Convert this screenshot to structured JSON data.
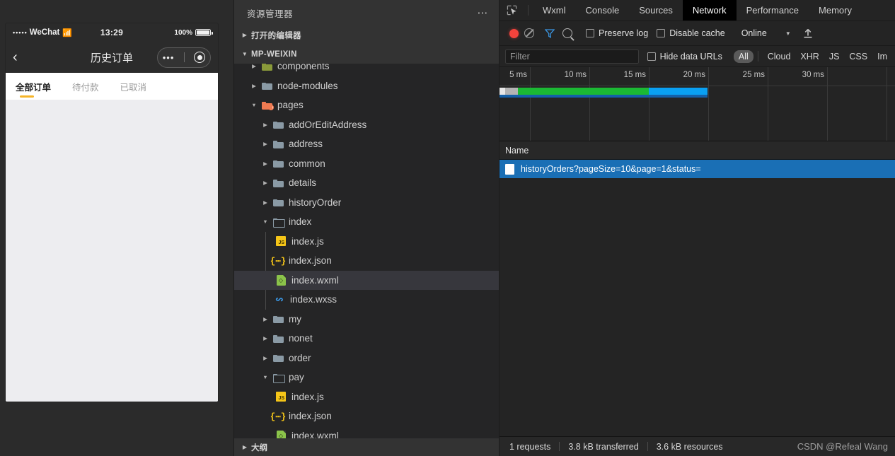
{
  "simulator": {
    "status_bar": {
      "signal_dots": "•••••",
      "carrier": "WeChat",
      "wifi_icon": "wifi-icon",
      "time": "13:29",
      "battery_percent": "100%"
    },
    "nav_bar": {
      "back_icon": "chevron-left-icon",
      "title": "历史订单",
      "more_icon": "more-dots-icon",
      "target_icon": "target-circle-icon"
    },
    "tabs": [
      {
        "label": "全部订单",
        "active": true
      },
      {
        "label": "待付款",
        "active": false
      },
      {
        "label": "已取消",
        "active": false
      }
    ],
    "accent_color": "#f5b428",
    "content_bg": "#ededf0"
  },
  "explorer": {
    "title": "资源管理器",
    "more_icon": "ellipsis-icon",
    "sections": [
      {
        "label": "打开的编辑器",
        "expanded": false
      },
      {
        "label": "MP-WEIXIN",
        "expanded": true
      }
    ],
    "footer": {
      "label": "大纲",
      "expanded": false
    },
    "tree": [
      {
        "label": "components",
        "type": "folder-special",
        "indent": 1,
        "expanded": false,
        "clipped": true
      },
      {
        "label": "node-modules",
        "type": "folder",
        "indent": 1,
        "expanded": false
      },
      {
        "label": "pages",
        "type": "folder-pages",
        "indent": 1,
        "expanded": true
      },
      {
        "label": "addOrEditAddress",
        "type": "folder",
        "indent": 2,
        "expanded": false
      },
      {
        "label": "address",
        "type": "folder",
        "indent": 2,
        "expanded": false
      },
      {
        "label": "common",
        "type": "folder",
        "indent": 2,
        "expanded": false
      },
      {
        "label": "details",
        "type": "folder",
        "indent": 2,
        "expanded": false
      },
      {
        "label": "historyOrder",
        "type": "folder",
        "indent": 2,
        "expanded": false
      },
      {
        "label": "index",
        "type": "folder-open",
        "indent": 2,
        "expanded": true
      },
      {
        "label": "index.js",
        "type": "js",
        "indent": 3
      },
      {
        "label": "index.json",
        "type": "json",
        "indent": 3
      },
      {
        "label": "index.wxml",
        "type": "wxml",
        "indent": 3,
        "selected": true
      },
      {
        "label": "index.wxss",
        "type": "wxss",
        "indent": 3
      },
      {
        "label": "my",
        "type": "folder",
        "indent": 2,
        "expanded": false
      },
      {
        "label": "nonet",
        "type": "folder",
        "indent": 2,
        "expanded": false
      },
      {
        "label": "order",
        "type": "folder",
        "indent": 2,
        "expanded": false
      },
      {
        "label": "pay",
        "type": "folder-open",
        "indent": 2,
        "expanded": true
      },
      {
        "label": "index.js",
        "type": "js",
        "indent": 3
      },
      {
        "label": "index.json",
        "type": "json",
        "indent": 3
      },
      {
        "label": "index.wxml",
        "type": "wxml",
        "indent": 3
      }
    ]
  },
  "devtools": {
    "inspect_icon": "inspect-element-icon",
    "tabs": [
      {
        "label": "Wxml",
        "active": false
      },
      {
        "label": "Console",
        "active": false
      },
      {
        "label": "Sources",
        "active": false
      },
      {
        "label": "Network",
        "active": true
      },
      {
        "label": "Performance",
        "active": false
      },
      {
        "label": "Memory",
        "active": false
      }
    ],
    "toolbar": {
      "record_icon": "record-red-dot-icon",
      "clear_icon": "clear-circle-slash-icon",
      "filter_icon": "funnel-filter-icon",
      "search_icon": "search-magnifier-icon",
      "preserve_log": {
        "label": "Preserve log",
        "checked": false
      },
      "disable_cache": {
        "label": "Disable cache",
        "checked": false
      },
      "throttling": "Online",
      "dropdown_icon": "chevron-down-icon",
      "upload_icon": "upload-arrow-icon"
    },
    "filterbar": {
      "filter_placeholder": "Filter",
      "filter_value": "",
      "hide_data_urls": {
        "label": "Hide data URLs",
        "checked": false
      },
      "types": [
        {
          "label": "All",
          "active": true
        },
        {
          "label": "Cloud",
          "active": false
        },
        {
          "label": "XHR",
          "active": false
        },
        {
          "label": "JS",
          "active": false
        },
        {
          "label": "CSS",
          "active": false
        },
        {
          "label": "Im",
          "active": false
        }
      ]
    },
    "overview": {
      "ticks": [
        "5 ms",
        "10 ms",
        "15 ms",
        "20 ms",
        "25 ms",
        "30 ms"
      ],
      "bar_segments": [
        {
          "name": "queue",
          "color": "#cfcfcf",
          "width_pct": 2.9,
          "muted": true
        },
        {
          "name": "stalled",
          "color": "#b0b0b0",
          "width_pct": 6.2
        },
        {
          "name": "waiting",
          "color": "#1bb934",
          "width_pct": 62.5
        },
        {
          "name": "download",
          "color": "#0aa0f2",
          "width_pct": 20.0
        }
      ],
      "total_bar_color": "#1560a8"
    },
    "list": {
      "column_header": "Name",
      "rows": [
        {
          "name": "historyOrders?pageSize=10&page=1&status=",
          "selected": true,
          "icon": "document-icon"
        }
      ]
    },
    "status_bar": {
      "requests": "1 requests",
      "transferred": "3.8 kB transferred",
      "resources": "3.6 kB resources",
      "watermark": "CSDN @Refeal Wang"
    }
  }
}
